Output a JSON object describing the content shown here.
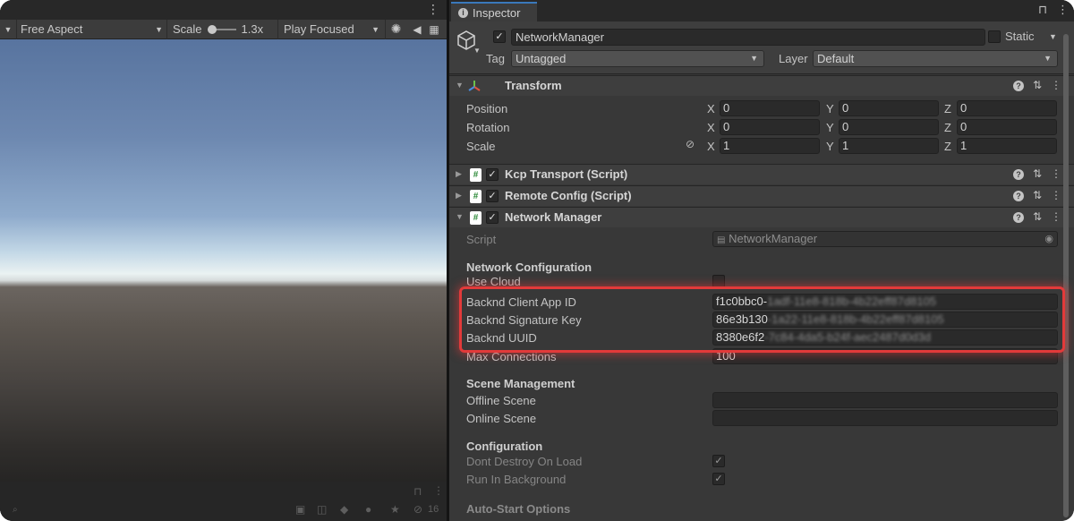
{
  "game_view": {
    "aspect_label": "Free Aspect",
    "scale_label": "Scale",
    "scale_value": "1.3x",
    "play_mode_label": "Play Focused",
    "status_count": "16"
  },
  "inspector": {
    "tab_label": "Inspector",
    "gameobject": {
      "name": "NetworkManager",
      "static_label": "Static",
      "tag_label": "Tag",
      "tag_value": "Untagged",
      "layer_label": "Layer",
      "layer_value": "Default"
    },
    "transform": {
      "title": "Transform",
      "rows": [
        {
          "label": "Position",
          "x": "0",
          "y": "0",
          "z": "0"
        },
        {
          "label": "Rotation",
          "x": "0",
          "y": "0",
          "z": "0"
        },
        {
          "label": "Scale",
          "x": "1",
          "y": "1",
          "z": "1"
        }
      ]
    },
    "components": [
      {
        "title": "Kcp Transport (Script)"
      },
      {
        "title": "Remote Config (Script)"
      },
      {
        "title": "Network Manager"
      }
    ],
    "network_manager": {
      "script_label": "Script",
      "script_value": "NetworkManager",
      "network_configuration_header": "Network Configuration",
      "use_cloud_label": "Use Cloud",
      "client_app_id_label": "Backnd Client App ID",
      "client_app_id_visible": "f1c0bbc0-",
      "client_app_id_blurred": "1adf-11e8-818b-4b22eff87d8105",
      "signature_key_label": "Backnd Signature Key",
      "signature_key_visible": "86e3b130",
      "signature_key_blurred": "-1a22-11e8-818b-4b22eff87d8105",
      "uuid_label": "Backnd UUID",
      "uuid_visible": "8380e6f2",
      "uuid_blurred": "-7c84-4da5-b24f-aec2487d0d3d",
      "max_connections_label": "Max Connections",
      "max_connections_value": "100",
      "scene_management_header": "Scene Management",
      "offline_scene_label": "Offline Scene",
      "online_scene_label": "Online Scene",
      "configuration_header": "Configuration",
      "dont_destroy_label": "Dont Destroy On Load",
      "run_in_background_label": "Run In Background",
      "auto_start_header": "Auto-Start Options"
    },
    "colors": {
      "highlight": "#e23a3a",
      "tab_accent": "#3a79bb"
    }
  }
}
